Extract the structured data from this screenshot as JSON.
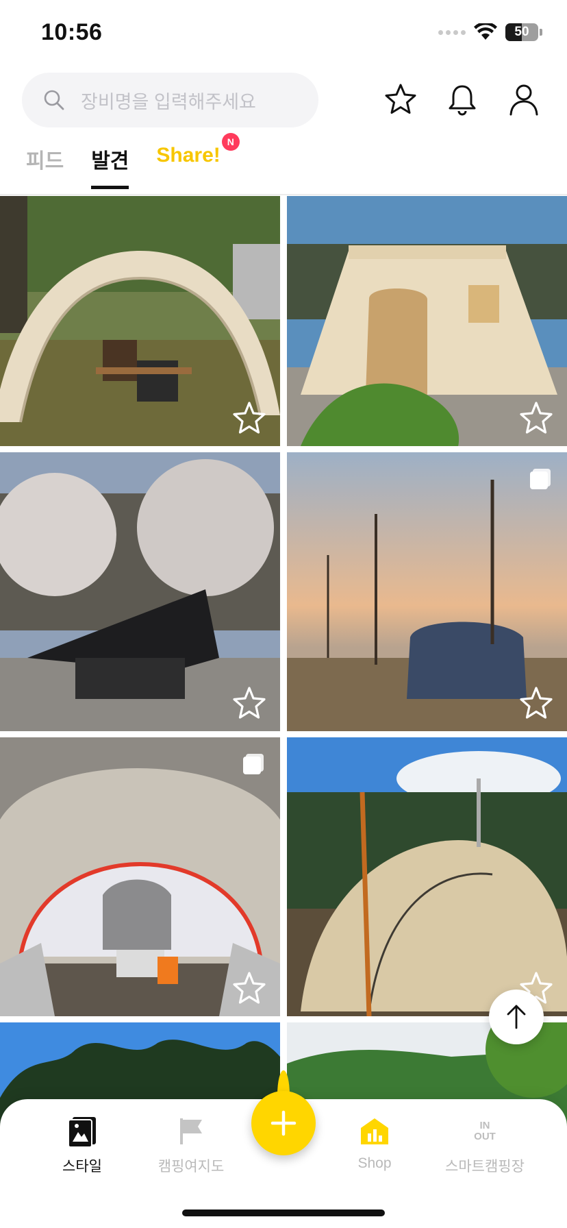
{
  "status_bar": {
    "time": "10:56",
    "battery": "50",
    "battery_level": 0.5
  },
  "search": {
    "placeholder": "장비명을 입력해주세요"
  },
  "header_icons": [
    "star-outline-icon",
    "bell-icon",
    "profile-icon"
  ],
  "tabs": [
    {
      "label": "피드",
      "active": false
    },
    {
      "label": "발견",
      "active": true
    },
    {
      "label": "Share!",
      "active": false,
      "badge": "N"
    }
  ],
  "grid": {
    "photos": [
      {
        "subject": "beige tunnel tent with camping chairs",
        "multiple": false,
        "favorited": false
      },
      {
        "subject": "cream cotton cabin tent",
        "multiple": false,
        "favorited": false
      },
      {
        "subject": "black tarp under cherry blossoms",
        "multiple": false,
        "favorited": false
      },
      {
        "subject": "navy tunnel tent at sunset",
        "multiple": true,
        "favorited": false
      },
      {
        "subject": "tent interior with red frame",
        "multiple": true,
        "favorited": false
      },
      {
        "subject": "beige dome tent with lanterns",
        "multiple": false,
        "favorited": false
      },
      {
        "subject": "tree line under blue sky",
        "multiple": false,
        "favorited": false
      },
      {
        "subject": "green hills",
        "multiple": false,
        "favorited": false
      }
    ]
  },
  "bottom_nav": {
    "items": [
      {
        "label": "스타일",
        "icon": "style-icon",
        "active": true
      },
      {
        "label": "캠핑여지도",
        "icon": "flag-icon",
        "active": false
      },
      {
        "label": "Shop",
        "icon": "shop-icon",
        "active": false
      },
      {
        "label": "스마트캠핑장",
        "icon": "in-out-icon",
        "icon_text_top": "IN",
        "icon_text_bottom": "OUT",
        "active": false
      }
    ],
    "fab": "add-icon"
  },
  "colors": {
    "accent_yellow": "#ffd600",
    "share_yellow": "#f7c600",
    "badge_red": "#ff3b5c"
  }
}
